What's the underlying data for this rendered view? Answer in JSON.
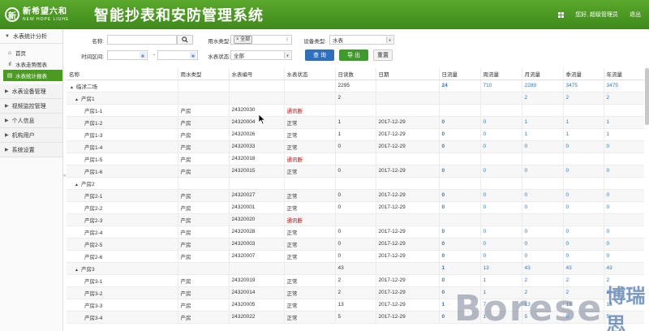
{
  "header": {
    "logo_cn": "新希望六和",
    "logo_en": "NEW HOPE LIUHE",
    "app_title": "智能抄表和安防管理系统",
    "greeting": "您好, 超级管理员",
    "logout": "退出"
  },
  "sidebar": {
    "group_water_stats": "水表统计分析",
    "item_home": "首页",
    "item_trend": "水表走势图表",
    "item_report": "水表统计报表",
    "group_device": "水表设备管理",
    "group_video": "视频监控管理",
    "group_personal": "个人信息",
    "group_org": "机构用户",
    "group_system": "系统设置"
  },
  "filters": {
    "name_label": "名称:",
    "name_value": "",
    "water_type_label": "用水类型:",
    "water_type_tag": "全部",
    "device_type_label": "设备类型:",
    "device_type_value": "水表",
    "time_label": "时间区间:",
    "time_sep": "-",
    "meter_status_label": "水表状态:",
    "meter_status_value": "全部",
    "query_button": "查 询",
    "export_button": "导 出",
    "reset_button": "重置"
  },
  "table": {
    "headers": [
      "名称",
      "用水类型",
      "水表编号",
      "水表状态",
      "日读数",
      "日期",
      "日流量",
      "周流量",
      "月流量",
      "季流量",
      "年流量"
    ],
    "rows": [
      {
        "level": 0,
        "tree": "▲",
        "name": "临沭二场",
        "type": "",
        "code": "",
        "status": "",
        "reading": "2295",
        "date": "",
        "day": "24",
        "week": "710",
        "month": "2289",
        "quarter": "3475",
        "year": "3475",
        "status_err": false
      },
      {
        "level": 1,
        "tree": "▲",
        "name": "产房1",
        "type": "",
        "code": "",
        "status": "",
        "reading": "2",
        "date": "",
        "day": "",
        "week": "",
        "month": "2",
        "quarter": "2",
        "year": "2",
        "status_err": false
      },
      {
        "level": 2,
        "tree": "",
        "name": "产房1-1",
        "type": "产房",
        "code": "24320030",
        "status": "通讯断",
        "reading": "",
        "date": "",
        "day": "",
        "week": "",
        "month": "",
        "quarter": "",
        "year": "",
        "status_err": true
      },
      {
        "level": 2,
        "tree": "",
        "name": "产房1-2",
        "type": "产房",
        "code": "24320004",
        "status": "正常",
        "reading": "1",
        "date": "2017-12-29",
        "day": "0",
        "week": "0",
        "month": "1",
        "quarter": "1",
        "year": "1",
        "status_err": false
      },
      {
        "level": 2,
        "tree": "",
        "name": "产房1-3",
        "type": "产房",
        "code": "24320026",
        "status": "正常",
        "reading": "1",
        "date": "2017-12-29",
        "day": "0",
        "week": "0",
        "month": "1",
        "quarter": "1",
        "year": "1",
        "status_err": false
      },
      {
        "level": 2,
        "tree": "",
        "name": "产房1-4",
        "type": "产房",
        "code": "24320033",
        "status": "正常",
        "reading": "0",
        "date": "2017-12-29",
        "day": "0",
        "week": "0",
        "month": "0",
        "quarter": "0",
        "year": "0",
        "status_err": false
      },
      {
        "level": 2,
        "tree": "",
        "name": "产房1-5",
        "type": "产房",
        "code": "24320018",
        "status": "通讯断",
        "reading": "",
        "date": "",
        "day": "",
        "week": "",
        "month": "",
        "quarter": "",
        "year": "",
        "status_err": true
      },
      {
        "level": 2,
        "tree": "",
        "name": "产房1-6",
        "type": "产房",
        "code": "24320015",
        "status": "正常",
        "reading": "0",
        "date": "2017-12-29",
        "day": "0",
        "week": "0",
        "month": "0",
        "quarter": "0",
        "year": "0",
        "status_err": false
      },
      {
        "level": 1,
        "tree": "▲",
        "name": "产房2",
        "type": "",
        "code": "",
        "status": "",
        "reading": "",
        "date": "",
        "day": "",
        "week": "",
        "month": "",
        "quarter": "",
        "year": "",
        "status_err": false
      },
      {
        "level": 2,
        "tree": "",
        "name": "产房2-1",
        "type": "产房",
        "code": "24320027",
        "status": "正常",
        "reading": "0",
        "date": "2017-12-29",
        "day": "0",
        "week": "0",
        "month": "0",
        "quarter": "0",
        "year": "0",
        "status_err": false
      },
      {
        "level": 2,
        "tree": "",
        "name": "产房2-2",
        "type": "产房",
        "code": "24320001",
        "status": "正常",
        "reading": "0",
        "date": "2017-12-29",
        "day": "0",
        "week": "0",
        "month": "0",
        "quarter": "0",
        "year": "0",
        "status_err": false
      },
      {
        "level": 2,
        "tree": "",
        "name": "产房2-3",
        "type": "产房",
        "code": "24320020",
        "status": "通讯断",
        "reading": "",
        "date": "",
        "day": "",
        "week": "",
        "month": "",
        "quarter": "",
        "year": "",
        "status_err": true
      },
      {
        "level": 2,
        "tree": "",
        "name": "产房2-4",
        "type": "产房",
        "code": "24320028",
        "status": "正常",
        "reading": "0",
        "date": "2017-12-29",
        "day": "0",
        "week": "0",
        "month": "0",
        "quarter": "0",
        "year": "0",
        "status_err": false
      },
      {
        "level": 2,
        "tree": "",
        "name": "产房2-5",
        "type": "产房",
        "code": "24320003",
        "status": "正常",
        "reading": "0",
        "date": "2017-12-29",
        "day": "0",
        "week": "0",
        "month": "0",
        "quarter": "0",
        "year": "0",
        "status_err": false
      },
      {
        "level": 2,
        "tree": "",
        "name": "产房2-6",
        "type": "产房",
        "code": "24320007",
        "status": "正常",
        "reading": "0",
        "date": "2017-12-29",
        "day": "0",
        "week": "0",
        "month": "0",
        "quarter": "0",
        "year": "0",
        "status_err": false
      },
      {
        "level": 1,
        "tree": "▲",
        "name": "产房3",
        "type": "",
        "code": "",
        "status": "",
        "reading": "43",
        "date": "",
        "day": "1",
        "week": "13",
        "month": "43",
        "quarter": "43",
        "year": "43",
        "status_err": false
      },
      {
        "level": 2,
        "tree": "",
        "name": "产房3-1",
        "type": "产房",
        "code": "24320019",
        "status": "正常",
        "reading": "2",
        "date": "2017-12-29",
        "day": "0",
        "week": "1",
        "month": "2",
        "quarter": "2",
        "year": "2",
        "status_err": false
      },
      {
        "level": 2,
        "tree": "",
        "name": "产房3-2",
        "type": "产房",
        "code": "24320014",
        "status": "正常",
        "reading": "2",
        "date": "2017-12-29",
        "day": "0",
        "week": "1",
        "month": "2",
        "quarter": "2",
        "year": "2",
        "status_err": false
      },
      {
        "level": 2,
        "tree": "",
        "name": "产房3-3",
        "type": "产房",
        "code": "24320005",
        "status": "正常",
        "reading": "13",
        "date": "2017-12-29",
        "day": "1",
        "week": "7",
        "month": "13",
        "quarter": "13",
        "year": "13",
        "status_err": false
      },
      {
        "level": 2,
        "tree": "",
        "name": "产房3-4",
        "type": "产房",
        "code": "24320022",
        "status": "正常",
        "reading": "5",
        "date": "2017-12-29",
        "day": "0",
        "week": "1",
        "month": "5",
        "quarter": "5",
        "year": "5",
        "status_err": false
      }
    ]
  },
  "watermark": {
    "latin": "Borese",
    "cn": "博瑞思"
  },
  "colors": {
    "header_green": "#4a9a24",
    "active_green": "#4b9b22",
    "blue": "#2b7bc8",
    "error_red": "#d40000"
  }
}
